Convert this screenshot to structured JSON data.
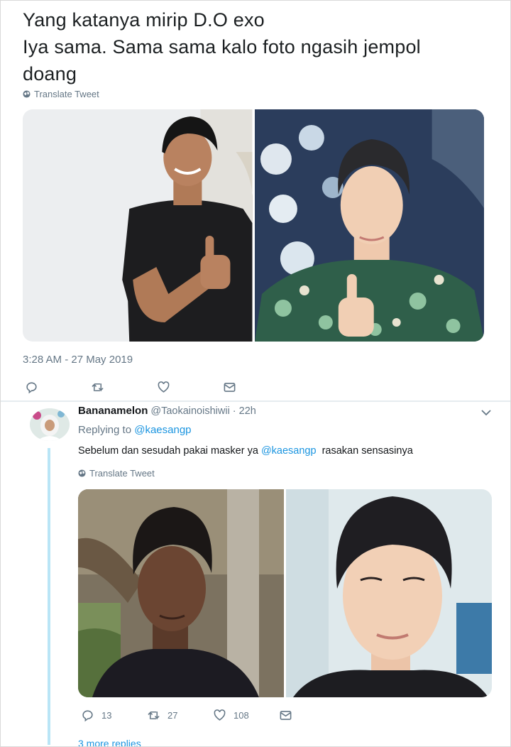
{
  "main_tweet": {
    "text": "Yang katanya mirip D.O exo\nIya sama. Sama sama kalo foto ngasih jempol\ndoang",
    "translate_label": "Translate Tweet",
    "timestamp": "3:28 AM - 27 May 2019",
    "actions": {
      "reply_count": "",
      "retweet_count": "",
      "like_count": ""
    }
  },
  "reply": {
    "display_name": "Bananamelon",
    "handle": "@Taokainoishiwii",
    "separator": "·",
    "time": "22h",
    "replying_prefix": "Replying to",
    "replying_to": "@kaesangp",
    "text_before": "Sebelum dan sesudah pakai masker ya ",
    "text_mention": "@kaesangp",
    "text_after": "  rasakan sensasinya",
    "translate_label": "Translate Tweet",
    "actions": {
      "reply_count": "13",
      "retweet_count": "27",
      "like_count": "108"
    },
    "more_replies": "3 more replies"
  },
  "colors": {
    "link": "#1b95e0",
    "muted": "#657786",
    "thread_line": "#b9e5f6"
  },
  "icons": [
    "globe-icon",
    "reply-icon",
    "retweet-icon",
    "like-icon",
    "dm-icon",
    "chevron-down-icon"
  ]
}
